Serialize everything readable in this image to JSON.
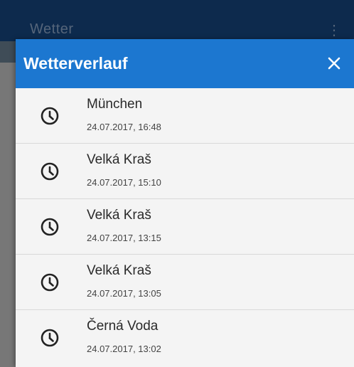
{
  "background": {
    "app_title_partial": "Wetter",
    "menu_glyph": "⋮"
  },
  "dialog": {
    "title": "Wetterverlauf",
    "close_icon": "close-icon"
  },
  "history": [
    {
      "city": "München",
      "datetime": "24.07.2017, 16:48"
    },
    {
      "city": "Velká Kraš",
      "datetime": "24.07.2017, 15:10"
    },
    {
      "city": "Velká Kraš",
      "datetime": "24.07.2017, 13:15"
    },
    {
      "city": "Velká Kraš",
      "datetime": "24.07.2017, 13:05"
    },
    {
      "city": "Černá Voda",
      "datetime": "24.07.2017, 13:02"
    }
  ],
  "colors": {
    "header": "#1c77d0",
    "list_bg": "#f4f4f4",
    "appbar_bg": "#0d2a4d"
  }
}
